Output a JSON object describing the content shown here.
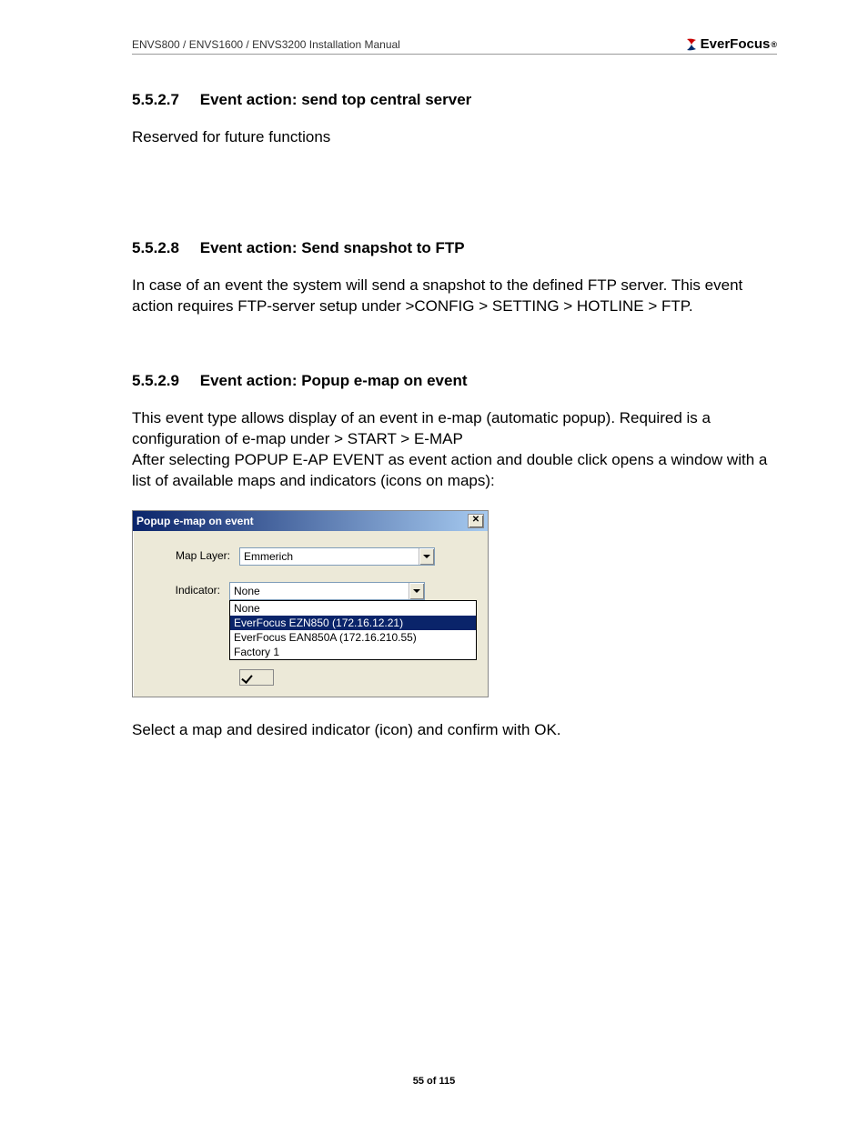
{
  "header": {
    "doc_title": "ENVS800 / ENVS1600 / ENVS3200 Installation Manual",
    "brand": "EverFocus"
  },
  "sections": {
    "s1": {
      "num": "5.5.2.7",
      "title": "Event action: send top central server"
    },
    "s1_body": "Reserved for future functions",
    "s2": {
      "num": "5.5.2.8",
      "title": "Event action: Send snapshot to FTP"
    },
    "s2_body": "In case of an event the system will send a snapshot to the defined FTP server. This event action requires FTP-server setup under >CONFIG > SETTING > HOTLINE > FTP.",
    "s3": {
      "num": "5.5.2.9",
      "title": "Event action: Popup e-map on event"
    },
    "s3_body": "This  event type allows display of an event in e-map (automatic popup). Required is a configuration of e-map under > START > E-MAP\nAfter selecting POPUP E-AP EVENT as event action and double click opens a window with a list of available maps and indicators (icons on maps):",
    "s3_after": "Select a map and desired indicator (icon) and confirm with OK."
  },
  "dialog": {
    "title": "Popup e-map on event",
    "map_layer_label": "Map Layer:",
    "map_layer_value": "Emmerich",
    "indicator_label": "Indicator:",
    "indicator_value": "None",
    "options": [
      "None",
      "EverFocus EZN850 (172.16.12.21)",
      "EverFocus EAN850A (172.16.210.55)",
      "Factory 1"
    ]
  },
  "footer": "55 of 115"
}
